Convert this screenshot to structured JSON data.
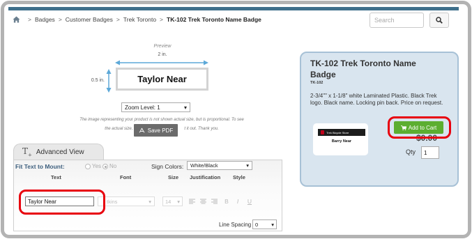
{
  "breadcrumb": {
    "icon": "home-icon",
    "items": [
      "Badges",
      "Customer Badges",
      "Trek Toronto"
    ],
    "current": "TK-102 Trek Toronto Name Badge",
    "separator": ">"
  },
  "search": {
    "placeholder": "Search",
    "button_icon": "search-icon"
  },
  "preview": {
    "label": "Preview",
    "width_label": "2 in.",
    "height_label": "0.5 in.",
    "badge_text": "Taylor Near",
    "zoom_value": "Zoom Level: 1",
    "disclaimer_line1": "The image representing your product is not shown actual size, but is proportional. To see",
    "disclaimer_line2_left": "the actual size, sa",
    "disclaimer_line2_right": "t it out. Thank you.",
    "save_pdf_label": "Save PDF"
  },
  "advanced": {
    "tab_label": "Advanced View",
    "fit_label": "Fit Text to Mount:",
    "fit_yes": "Yes",
    "fit_no": "No",
    "sign_colors_label": "Sign Colors:",
    "sign_colors_value": "White/Black",
    "columns": {
      "text": "Text",
      "font": "Font",
      "size": "Size",
      "justification": "Justification",
      "style": "Style"
    },
    "text_value": "Taylor Near",
    "font_value": "tkins",
    "size_value": "14",
    "style_bold": "B",
    "style_italic": "I",
    "style_underline": "U",
    "line_spacing_label": "Line Spacing",
    "line_spacing_value": "0"
  },
  "product": {
    "title": "TK-102 Trek Toronto Name Badge",
    "sku": "TK-102",
    "description": "2-3/4\"\" x 1-1/8\" white Laminated Plastic. Black Trek logo. Black name. Locking pin back. Price on request.",
    "thumb_brand": "Trek Bicycle Store",
    "thumb_name": "Barry Near",
    "add_to_cart_label": "Add to Cart",
    "price": "$0.00",
    "qty_label": "Qty",
    "qty_value": "1"
  },
  "colors": {
    "accent_bar": "#3e6f8b",
    "highlight": "#e8000d",
    "cart_button": "#5cae30",
    "card_bg": "#d9e5ef"
  }
}
